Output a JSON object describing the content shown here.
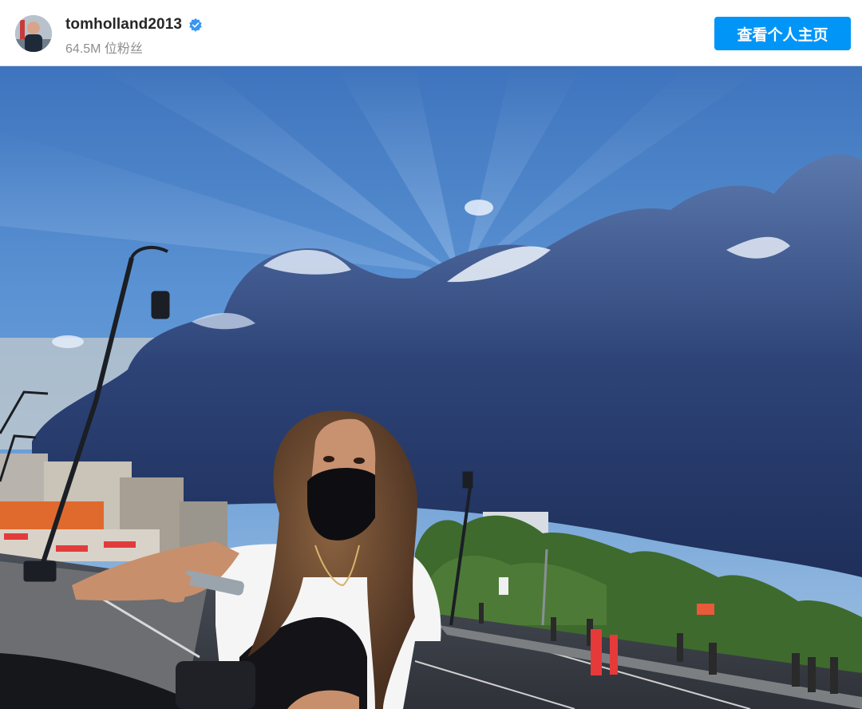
{
  "header": {
    "username": "tomholland2013",
    "followers": "64.5M 位粉丝",
    "profile_button_label": "查看个人主页",
    "verified_icon": "verified-badge-icon",
    "accent_color": "#0095f6"
  },
  "post": {
    "image": "sunset-sky-photo",
    "subject": "woman-in-black-mask-on-scooter"
  }
}
